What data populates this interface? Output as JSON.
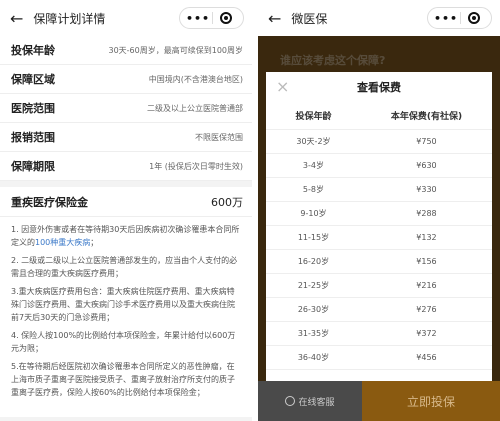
{
  "left": {
    "header": {
      "back_icon": "arrow-left-icon",
      "title": "保障计划详情"
    },
    "rows": [
      {
        "key": "投保年龄",
        "value": "30天-60周岁，最高可续保到100周岁"
      },
      {
        "key": "保障区域",
        "value": "中国境内(不含港澳台地区)"
      },
      {
        "key": "医院范围",
        "value": "二级及以上公立医院普通部"
      },
      {
        "key": "报销范围",
        "value": "不限医保范围"
      },
      {
        "key": "保障期限",
        "value": "1年 (投保后次日零时生效)"
      }
    ],
    "critical": {
      "key": "重疾医疗保险金",
      "value": "600万"
    },
    "notes": [
      {
        "text": "1. 因意外伤害或者在等待期30天后因疾病初次确诊罹患本合同所定义的",
        "link": "100种重大疾病",
        "tail": "；"
      },
      {
        "text": "2. 二级或二级以上公立医院普通部发生的，应当由个人支付的必需且合理的重大疾病医疗费用；",
        "link": "",
        "tail": ""
      },
      {
        "text": "3.重大疾病医疗费用包含：重大疾病住院医疗费用、重大疾病特殊门诊医疗费用、重大疾病门诊手术医疗费用以及重大疾病住院前7天后30天的门急诊费用；",
        "link": "",
        "tail": ""
      },
      {
        "text": "4. 保险人按100%的比例给付本项保险金，年累计给付以600万元为限；",
        "link": "",
        "tail": ""
      },
      {
        "text": "5.在等待期后经医院初次确诊罹患本合同所定义的恶性肿瘤，在上海市质子重离子医院接受质子、重离子放射治疗所支付的质子重离子医疗费，保险人按60%的比例给付本项保险金；",
        "link": "",
        "tail": ""
      }
    ]
  },
  "right": {
    "header": {
      "back_icon": "arrow-left-icon",
      "title": "微医保"
    },
    "background_text": "谁应该考虑这个保障?",
    "modal": {
      "close_icon": "close-icon",
      "title": "查看保费",
      "columns": [
        "投保年龄",
        "本年保费(有社保)"
      ],
      "rows": [
        {
          "age": "30天-2岁",
          "premium": "¥750"
        },
        {
          "age": "3-4岁",
          "premium": "¥630"
        },
        {
          "age": "5-8岁",
          "premium": "¥330"
        },
        {
          "age": "9-10岁",
          "premium": "¥288"
        },
        {
          "age": "11-15岁",
          "premium": "¥132"
        },
        {
          "age": "16-20岁",
          "premium": "¥156"
        },
        {
          "age": "21-25岁",
          "premium": "¥216"
        },
        {
          "age": "26-30岁",
          "premium": "¥276"
        },
        {
          "age": "31-35岁",
          "premium": "¥372"
        },
        {
          "age": "36-40岁",
          "premium": "¥456"
        }
      ]
    },
    "bottom": {
      "service_label": "在线客服",
      "buy_label": "立即投保"
    }
  },
  "capsule": {
    "more_icon": "more-dots-icon",
    "close_icon": "target-close-icon",
    "dots": "•••"
  }
}
